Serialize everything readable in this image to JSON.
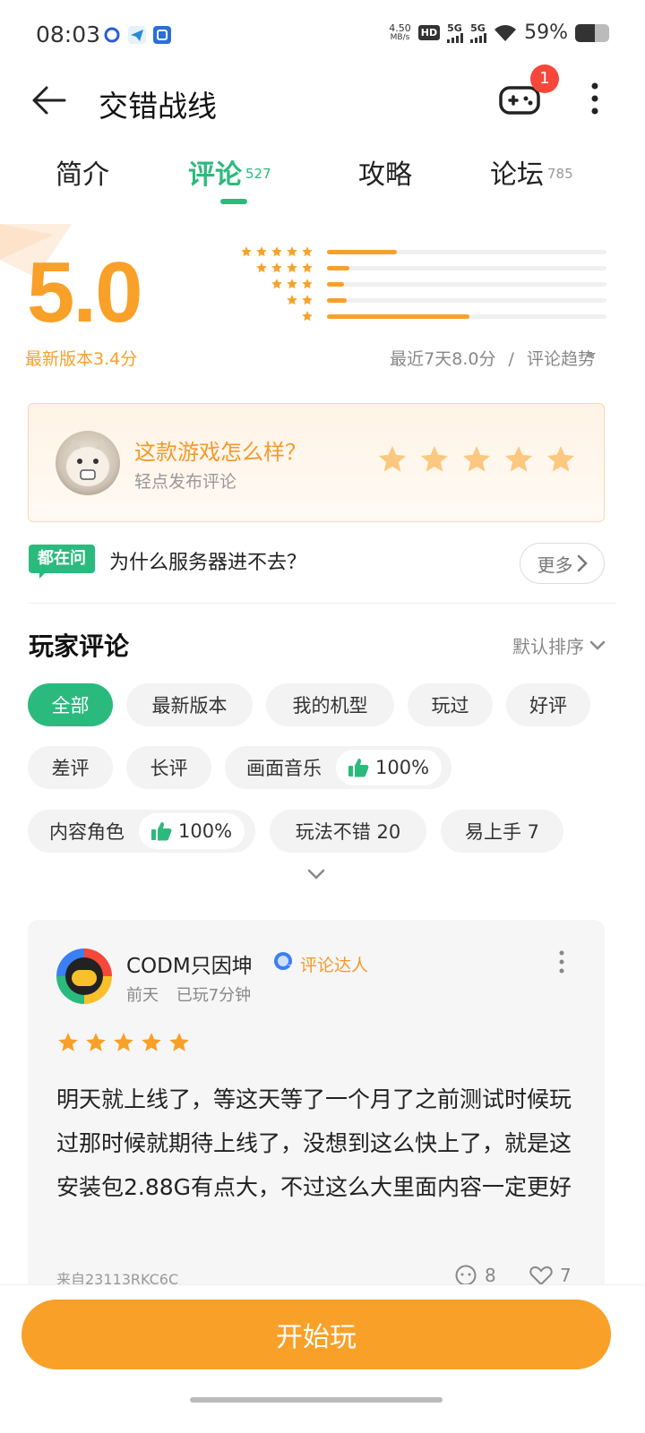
{
  "status_bar": {
    "time": "08:03",
    "netspeed_value": "4.50",
    "netspeed_unit": "MB/s",
    "hd_label": "HD",
    "sim1": "5G",
    "sim2": "5G",
    "battery_pct": "59%",
    "battery_level": 0.59
  },
  "header": {
    "title": "交错战线",
    "badge_count": "1"
  },
  "tabs": [
    {
      "label": "简介",
      "count": ""
    },
    {
      "label": "评论",
      "count": "527"
    },
    {
      "label": "攻略",
      "count": ""
    },
    {
      "label": "论坛",
      "count": "785"
    }
  ],
  "rating": {
    "score": "5.0",
    "latest_version": "最新版本3.4分",
    "recent_label": "最近7天8.0分",
    "separator": "/",
    "trend_label": "评论趋势",
    "distribution": [
      {
        "stars": 5,
        "fraction": 0.25
      },
      {
        "stars": 4,
        "fraction": 0.08
      },
      {
        "stars": 3,
        "fraction": 0.06
      },
      {
        "stars": 2,
        "fraction": 0.07
      },
      {
        "stars": 1,
        "fraction": 0.51
      }
    ]
  },
  "rate_prompt": {
    "title": "这款游戏怎么样？",
    "subtitle": "轻点发布评论"
  },
  "ask": {
    "badge": "都在问",
    "question": "为什么服务器进不去？",
    "more": "更多"
  },
  "reviews_section": {
    "title": "玩家评论",
    "sort": "默认排序"
  },
  "filters": [
    {
      "label": "全部",
      "pct": ""
    },
    {
      "label": "最新版本",
      "pct": ""
    },
    {
      "label": "我的机型",
      "pct": ""
    },
    {
      "label": "玩过",
      "pct": ""
    },
    {
      "label": "好评",
      "pct": ""
    },
    {
      "label": "差评",
      "pct": ""
    },
    {
      "label": "长评",
      "pct": ""
    },
    {
      "label": "画面音乐",
      "pct": "100%"
    },
    {
      "label": "内容角色",
      "pct": "100%"
    },
    {
      "label": "玩法不错 20",
      "pct": ""
    },
    {
      "label": "易上手 7",
      "pct": ""
    }
  ],
  "review": {
    "username": "CODM只因坤",
    "tag": "评论达人",
    "time": "前天",
    "played": "已玩7分钟",
    "stars": 5,
    "text": "明天就上线了，等这天等了一个月了之前测试时候玩过那时候就期待上线了，没想到这么快上了，就是这安装包2.88G有点大，不过这么大里面内容一定更好",
    "device": "来自23113RKC6C",
    "comments": "8",
    "likes": "7"
  },
  "play_button": "开始玩",
  "colors": {
    "accent_green": "#2bba7e",
    "accent_orange": "#f9a029",
    "badge_red": "#f5483b"
  }
}
